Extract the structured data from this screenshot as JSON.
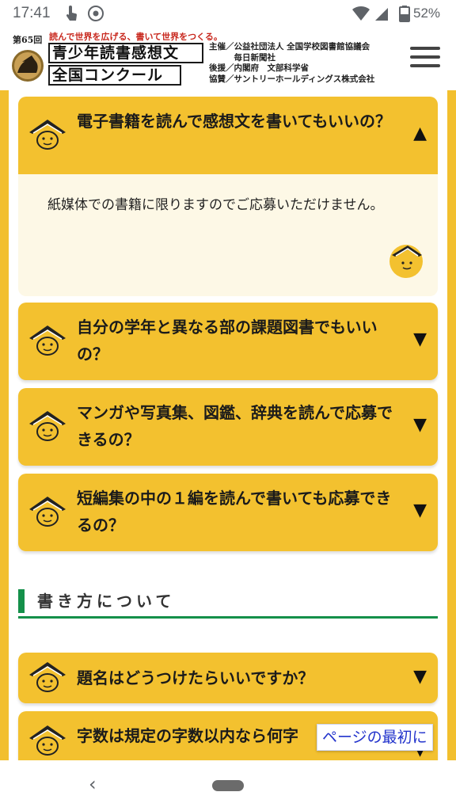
{
  "status_bar": {
    "time": "17:41",
    "battery": "52%"
  },
  "header": {
    "edition": "第65回",
    "tagline": "読んで世界を広げる、書いて世界をつくる。",
    "title_line1": "青少年読書感想文",
    "title_line2": "全国コンクール",
    "sponsors": [
      "主催／公益社団法人 全国学校図書館協議会",
      "　　　毎日新聞社",
      "後援／内閣府　文部科学省",
      "協賛／サントリーホールディングス株式会社"
    ]
  },
  "faq": {
    "open_item": {
      "question": "電子書籍を読んで感想文を書いてもいいの？",
      "answer": "紙媒体での書籍に限りますのでご応募いただけません。",
      "arrow": "▲"
    },
    "items": [
      {
        "question": "自分の学年と異なる部の課題図書でもいいの？",
        "arrow": "▼"
      },
      {
        "question": "マンガや写真集、図鑑、辞典を読んで応募できるの？",
        "arrow": "▼"
      },
      {
        "question": "短編集の中の１編を読んで書いても応募できるの？",
        "arrow": "▼"
      }
    ]
  },
  "section": {
    "title": "書き方について",
    "items": [
      {
        "question": "題名はどうつけたらいいですか？",
        "arrow": "▼"
      },
      {
        "question": "字数は規定の字数以内なら何字",
        "arrow": "▼"
      }
    ]
  },
  "to_top_button": "ページの最初に",
  "nav": {
    "back": "‹"
  },
  "colors": {
    "accent_yellow": "#f3c12f",
    "answer_bg": "#fdf8e6",
    "section_green": "#14904a",
    "title_red": "#c8281e",
    "link_blue": "#2233cc"
  }
}
